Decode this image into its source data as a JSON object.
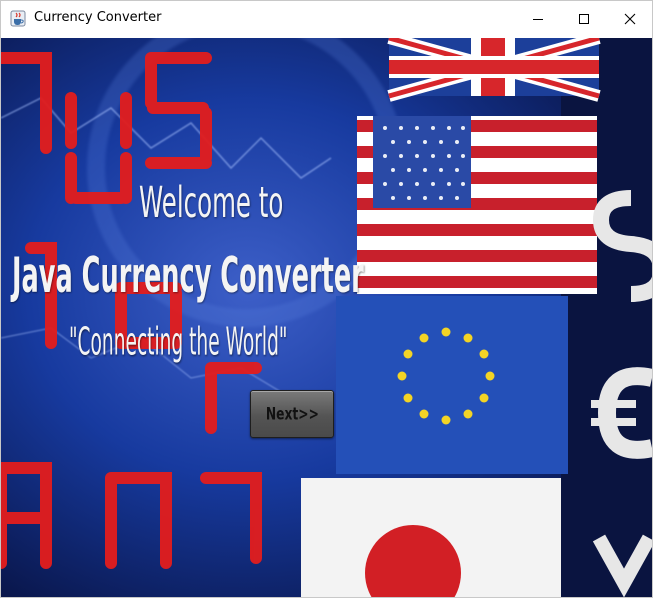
{
  "window": {
    "title": "Currency Converter",
    "app_icon": "java-cup-icon",
    "controls": {
      "minimize": "minimize-icon",
      "maximize": "maximize-icon",
      "close": "close-icon"
    }
  },
  "welcome": {
    "line1": "Welcome to",
    "line2": "Java Currency Converter",
    "tagline": "\"Connecting the World\""
  },
  "next_button": {
    "label": "Next>>"
  },
  "colors": {
    "background_blue": "#0b1f6e",
    "digit_red": "#e31d1d",
    "headline_text": "#f4f4f4",
    "button_gray": "#5a5a5a"
  }
}
